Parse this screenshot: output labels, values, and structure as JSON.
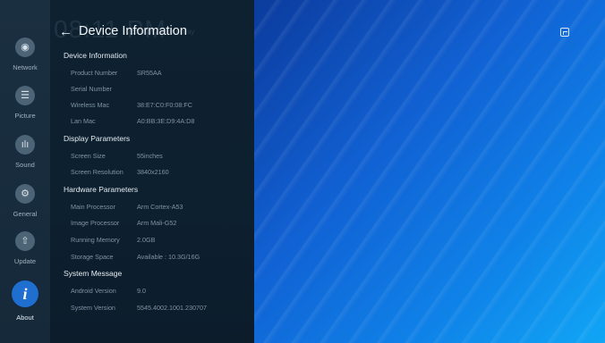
{
  "clock": {
    "time": "08:11 PM",
    "date": "2022/07/26  Thursday"
  },
  "header": {
    "back_icon": "arrow-left-icon",
    "title": "Device Information"
  },
  "nav": [
    {
      "label": "Network",
      "icon": "wifi-icon",
      "glyph": "◉"
    },
    {
      "label": "Picture",
      "icon": "sliders-icon",
      "glyph": "☰"
    },
    {
      "label": "Sound",
      "icon": "equalizer-icon",
      "glyph": "ılı"
    },
    {
      "label": "General",
      "icon": "general-settings-icon",
      "glyph": "⚙"
    },
    {
      "label": "Update",
      "icon": "update-arrow-icon",
      "glyph": "⇧"
    },
    {
      "label": "About",
      "icon": "info-icon",
      "glyph": "i",
      "active": true
    }
  ],
  "sections": {
    "device": {
      "title": "Device Information",
      "rows": [
        {
          "label": "Product Number",
          "value": "SR55AA"
        },
        {
          "label": "Serial Number",
          "value": ""
        },
        {
          "label": "Wireless Mac",
          "value": "38:E7:C0:F0:08:FC"
        },
        {
          "label": "Lan Mac",
          "value": "A0:BB:3E:D9:4A:D8"
        }
      ]
    },
    "display": {
      "title": "Display Parameters",
      "rows": [
        {
          "label": "Screen Size",
          "value": "55inches"
        },
        {
          "label": "Screen Resolution",
          "value": "3840x2160"
        }
      ]
    },
    "hardware": {
      "title": "Hardware Parameters",
      "rows": [
        {
          "label": "Main Processor",
          "value": "Arm Cortex-A53"
        },
        {
          "label": "Image Processor",
          "value": "Arm Mali-G52"
        },
        {
          "label": "Running Memory",
          "value": "2.0GB"
        },
        {
          "label": "Storage Space",
          "value": "Available : 10.3G/16G"
        }
      ]
    },
    "system": {
      "title": "System Message",
      "rows": [
        {
          "label": "Android Version",
          "value": "9.0"
        },
        {
          "label": "System Version",
          "value": "5545.4002.1001.230707"
        }
      ]
    }
  },
  "colors": {
    "accent": "#1e6fd0",
    "panel": "#0e2131",
    "rail": "#1a2f40"
  }
}
